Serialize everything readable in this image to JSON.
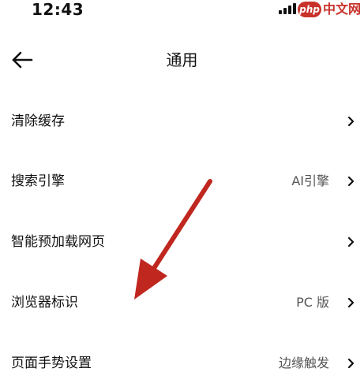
{
  "status_bar": {
    "time": "12:43",
    "icons": [
      "signal-icon"
    ],
    "watermark": {
      "brand": "php",
      "text": "中文网"
    }
  },
  "header": {
    "back_icon": "arrow-left-icon",
    "title": "通用"
  },
  "settings": [
    {
      "label": "清除缓存",
      "value": ""
    },
    {
      "label": "搜索引擎",
      "value": "AI引擎"
    },
    {
      "label": "智能预加载网页",
      "value": ""
    },
    {
      "label": "浏览器标识",
      "value": "PC 版"
    },
    {
      "label": "页面手势设置",
      "value": "边缘触发"
    }
  ],
  "annotation": {
    "color": "#c0271f",
    "icon": "red-arrow-annotation",
    "points_to": "浏览器标识"
  },
  "colors": {
    "text": "#111111",
    "secondary_text": "#555555",
    "watermark_red": "#c8322b"
  }
}
